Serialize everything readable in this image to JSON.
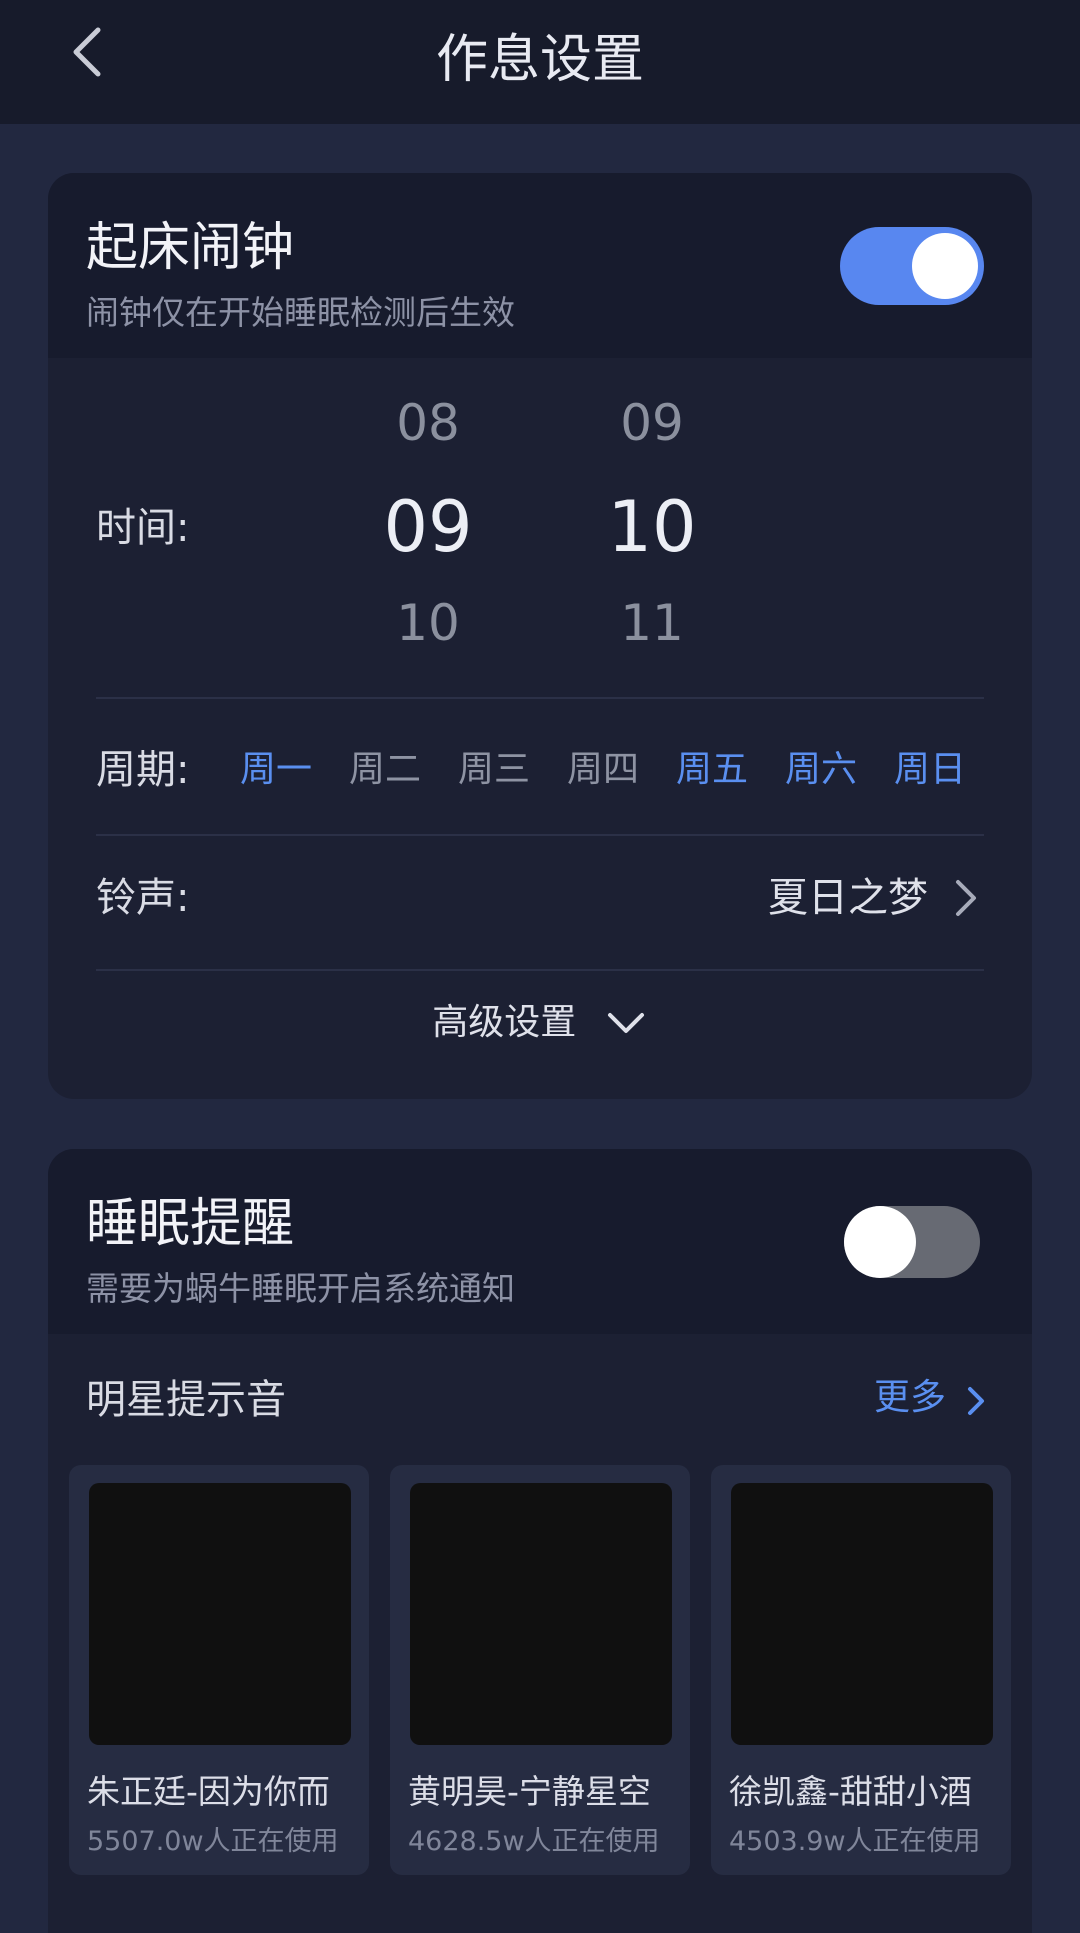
{
  "header": {
    "title": "作息设置"
  },
  "alarm": {
    "title": "起床闹钟",
    "subtitle": "闹钟仅在开始睡眠检测后生效",
    "enabled": true,
    "time_label": "时间:",
    "hours": [
      "08",
      "09",
      "10"
    ],
    "minutes": [
      "09",
      "10",
      "11"
    ],
    "period_label": "周期:",
    "days": [
      {
        "label": "周一",
        "active": true
      },
      {
        "label": "周二",
        "active": false
      },
      {
        "label": "周三",
        "active": false
      },
      {
        "label": "周四",
        "active": false
      },
      {
        "label": "周五",
        "active": true
      },
      {
        "label": "周六",
        "active": true
      },
      {
        "label": "周日",
        "active": true
      }
    ],
    "ringtone_label": "铃声:",
    "ringtone_value": "夏日之梦",
    "advanced_label": "高级设置"
  },
  "reminder": {
    "title": "睡眠提醒",
    "subtitle": "需要为蜗牛睡眠开启系统通知",
    "enabled": false,
    "section_title": "明星提示音",
    "more_label": "更多",
    "items": [
      {
        "title": "朱正廷-因为你而",
        "count": "5507.0w人正在使用"
      },
      {
        "title": "黄明昊-宁静星空",
        "count": "4628.5w人正在使用"
      },
      {
        "title": "徐凯鑫-甜甜小酒",
        "count": "4503.9w人正在使用"
      }
    ]
  },
  "colors": {
    "accent": "#5a8ff0",
    "toggle_on": "#5887f0",
    "toggle_off": "#676a73",
    "background": "#222840",
    "card": "#1c2033"
  }
}
